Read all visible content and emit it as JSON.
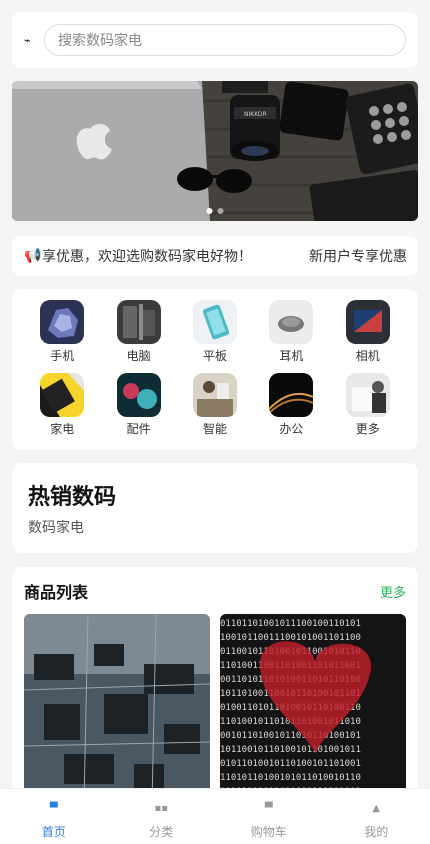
{
  "search": {
    "placeholder": "搜索数码家电",
    "scan_icon": "scan-icon"
  },
  "banner": {
    "slide_count": 2,
    "active_slide": 0
  },
  "notice": {
    "icon": "speaker-icon",
    "text": "享优惠，欢迎选购数码家电好物！",
    "right": "新用户专享优惠"
  },
  "categories": [
    {
      "label": "手机"
    },
    {
      "label": "电脑"
    },
    {
      "label": "平板"
    },
    {
      "label": "耳机"
    },
    {
      "label": "相机"
    },
    {
      "label": "家电"
    },
    {
      "label": "配件"
    },
    {
      "label": "智能"
    },
    {
      "label": "办公"
    },
    {
      "label": "更多"
    }
  ],
  "hot": {
    "title": "热销数码",
    "subtitle": "数码家电"
  },
  "product_list": {
    "title": "商品列表",
    "more": "更多"
  },
  "tabbar": [
    {
      "label": "首页",
      "icon": "home-icon",
      "active": true
    },
    {
      "label": "分类",
      "icon": "grid-icon",
      "active": false
    },
    {
      "label": "购物车",
      "icon": "cart-icon",
      "active": false
    },
    {
      "label": "我的",
      "icon": "user-icon",
      "active": false
    }
  ],
  "colors": {
    "accent": "#2a7de1",
    "more": "#27b15a",
    "background": "#f4f4f4"
  }
}
